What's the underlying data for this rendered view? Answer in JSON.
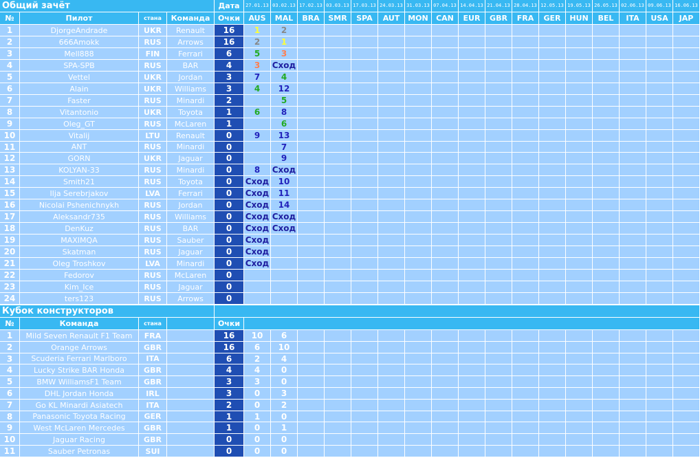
{
  "colors": {
    "header_bg": "#38b8f2",
    "cell_bg": "#a2d0ff",
    "points_bg": "#1f4eb3",
    "grid_line": "#ffffff"
  },
  "drivers": {
    "section_title": "Общий зачёт",
    "headers": {
      "no": "№",
      "pilot": "Пилот",
      "country": "стана",
      "team": "Команда",
      "date": "Дата",
      "points": "Очки"
    },
    "dates": [
      "27.01.13",
      "03.02.13",
      "17.02.13",
      "03.03.13",
      "17.03.13",
      "24.03.13",
      "31.03.13",
      "07.04.13",
      "14.04.13",
      "21.04.13",
      "28.04.13",
      "12.05.13",
      "19.05.13",
      "26.05.13",
      "02.06.13",
      "09.06.13",
      "16.06.13"
    ],
    "races": [
      "AUS",
      "MAL",
      "BRA",
      "SMR",
      "SPA",
      "AUT",
      "MON",
      "CAN",
      "EUR",
      "GBR",
      "FRA",
      "GER",
      "HUN",
      "BEL",
      "ITA",
      "USA",
      "JAP"
    ],
    "rows": [
      {
        "no": "1",
        "name": "DjorgeAndrade",
        "country": "UKR",
        "team": "Renault",
        "points": "16",
        "results": [
          {
            "v": "1",
            "c": "#ffff33"
          },
          {
            "v": "2",
            "c": "#888888"
          }
        ]
      },
      {
        "no": "2",
        "name": "666Amokk",
        "country": "RUS",
        "team": "Arrows",
        "points": "16",
        "results": [
          {
            "v": "2",
            "c": "#888888"
          },
          {
            "v": "1",
            "c": "#ffff33"
          }
        ]
      },
      {
        "no": "3",
        "name": "Mell888",
        "country": "FIN",
        "team": "Ferrari",
        "points": "6",
        "results": [
          {
            "v": "5",
            "c": "#22aa22"
          },
          {
            "v": "3",
            "c": "#ff7f50"
          }
        ]
      },
      {
        "no": "4",
        "name": "SPA-SPB",
        "country": "RUS",
        "team": "BAR",
        "points": "4",
        "results": [
          {
            "v": "3",
            "c": "#ff7f50"
          },
          {
            "v": "Сход",
            "c": "#2020a0"
          }
        ]
      },
      {
        "no": "5",
        "name": "Vettel",
        "country": "UKR",
        "team": "Jordan",
        "points": "3",
        "results": [
          {
            "v": "7",
            "c": "#2222bb"
          },
          {
            "v": "4",
            "c": "#22aa22"
          }
        ]
      },
      {
        "no": "6",
        "name": "Alain",
        "country": "UKR",
        "team": "Williams",
        "points": "3",
        "results": [
          {
            "v": "4",
            "c": "#22aa22"
          },
          {
            "v": "12",
            "c": "#2222bb"
          }
        ]
      },
      {
        "no": "7",
        "name": "Faster",
        "country": "RUS",
        "team": "Minardi",
        "points": "2",
        "results": [
          {
            "v": "",
            "c": ""
          },
          {
            "v": "5",
            "c": "#22aa22"
          }
        ]
      },
      {
        "no": "8",
        "name": "Vitantonio",
        "country": "UKR",
        "team": "Toyota",
        "points": "1",
        "results": [
          {
            "v": "6",
            "c": "#22aa22"
          },
          {
            "v": "8",
            "c": "#2222bb"
          }
        ]
      },
      {
        "no": "9",
        "name": "Oleg_GT",
        "country": "RUS",
        "team": "McLaren",
        "points": "1",
        "results": [
          {
            "v": "",
            "c": ""
          },
          {
            "v": "6",
            "c": "#22aa22"
          }
        ]
      },
      {
        "no": "10",
        "name": "Vitalij",
        "country": "LTU",
        "team": "Renault",
        "points": "0",
        "results": [
          {
            "v": "9",
            "c": "#2222bb"
          },
          {
            "v": "13",
            "c": "#2222bb"
          }
        ]
      },
      {
        "no": "11",
        "name": "ANT",
        "country": "RUS",
        "team": "Minardi",
        "points": "0",
        "results": [
          {
            "v": "",
            "c": ""
          },
          {
            "v": "7",
            "c": "#2222bb"
          }
        ]
      },
      {
        "no": "12",
        "name": "GORN",
        "country": "UKR",
        "team": "Jaguar",
        "points": "0",
        "results": [
          {
            "v": "",
            "c": ""
          },
          {
            "v": "9",
            "c": "#2222bb"
          }
        ]
      },
      {
        "no": "13",
        "name": "KOLYAN-33",
        "country": "RUS",
        "team": "Minardi",
        "points": "0",
        "results": [
          {
            "v": "8",
            "c": "#2222bb"
          },
          {
            "v": "Сход",
            "c": "#2020a0"
          }
        ]
      },
      {
        "no": "14",
        "name": "Smith21",
        "country": "RUS",
        "team": "Toyota",
        "points": "0",
        "results": [
          {
            "v": "Сход",
            "c": "#2020a0"
          },
          {
            "v": "10",
            "c": "#2222bb"
          }
        ]
      },
      {
        "no": "15",
        "name": "Ilja Serebrjakov",
        "country": "LVA",
        "team": "Ferrari",
        "points": "0",
        "results": [
          {
            "v": "Сход",
            "c": "#2020a0"
          },
          {
            "v": "11",
            "c": "#2222bb"
          }
        ]
      },
      {
        "no": "16",
        "name": "Nicolai Pshenichnykh",
        "country": "RUS",
        "team": "Jordan",
        "points": "0",
        "results": [
          {
            "v": "Сход",
            "c": "#2020a0"
          },
          {
            "v": "14",
            "c": "#2222bb"
          }
        ]
      },
      {
        "no": "17",
        "name": "Aleksandr735",
        "country": "RUS",
        "team": "Williams",
        "points": "0",
        "results": [
          {
            "v": "Сход",
            "c": "#2020a0"
          },
          {
            "v": "Сход",
            "c": "#2020a0"
          }
        ]
      },
      {
        "no": "18",
        "name": "DenKuz",
        "country": "RUS",
        "team": "BAR",
        "points": "0",
        "results": [
          {
            "v": "Сход",
            "c": "#2020a0"
          },
          {
            "v": "Сход",
            "c": "#2020a0"
          }
        ]
      },
      {
        "no": "19",
        "name": "MAXIMQA",
        "country": "RUS",
        "team": "Sauber",
        "points": "0",
        "results": [
          {
            "v": "Сход",
            "c": "#2020a0"
          },
          {
            "v": "",
            "c": ""
          }
        ]
      },
      {
        "no": "20",
        "name": "Skatman",
        "country": "RUS",
        "team": "Jaguar",
        "points": "0",
        "results": [
          {
            "v": "Сход",
            "c": "#2020a0"
          },
          {
            "v": "",
            "c": ""
          }
        ]
      },
      {
        "no": "21",
        "name": "Oleg Troshkov",
        "country": "LVA",
        "team": "Minardi",
        "points": "0",
        "results": [
          {
            "v": "Сход",
            "c": "#2020a0"
          },
          {
            "v": "",
            "c": ""
          }
        ]
      },
      {
        "no": "22",
        "name": "Fedorov",
        "country": "RUS",
        "team": "McLaren",
        "points": "0",
        "results": []
      },
      {
        "no": "23",
        "name": "Kim_Ice",
        "country": "RUS",
        "team": "Jaguar",
        "points": "0",
        "results": []
      },
      {
        "no": "24",
        "name": "ters123",
        "country": "RUS",
        "team": "Arrows",
        "points": "0",
        "results": []
      }
    ]
  },
  "constructors": {
    "section_title": "Кубок конструкторов",
    "headers": {
      "no": "№",
      "team": "Команда",
      "country": "стана",
      "points": "Очки"
    },
    "rows": [
      {
        "no": "1",
        "team": "Mild Seven Renault F1 Team",
        "country": "FRA",
        "points": "16",
        "results": [
          "10",
          "6"
        ]
      },
      {
        "no": "2",
        "team": "Orange Arrows",
        "country": "GBR",
        "points": "16",
        "results": [
          "6",
          "10"
        ]
      },
      {
        "no": "3",
        "team": "Scuderia Ferrari Marlboro",
        "country": "ITA",
        "points": "6",
        "results": [
          "2",
          "4"
        ]
      },
      {
        "no": "4",
        "team": "Lucky Strike BAR Honda",
        "country": "GBR",
        "points": "4",
        "results": [
          "4",
          "0"
        ]
      },
      {
        "no": "5",
        "team": "BMW WilliamsF1 Team",
        "country": "GBR",
        "points": "3",
        "results": [
          "3",
          "0"
        ]
      },
      {
        "no": "6",
        "team": "DHL Jordan Honda",
        "country": "IRL",
        "points": "3",
        "results": [
          "0",
          "3"
        ]
      },
      {
        "no": "7",
        "team": "Go KL Minardi Asiatech",
        "country": "ITA",
        "points": "2",
        "results": [
          "0",
          "2"
        ]
      },
      {
        "no": "8",
        "team": "Panasonic Toyota Racing",
        "country": "GER",
        "points": "1",
        "results": [
          "1",
          "0"
        ]
      },
      {
        "no": "9",
        "team": "West McLaren Mercedes",
        "country": "GBR",
        "points": "1",
        "results": [
          "0",
          "1"
        ]
      },
      {
        "no": "10",
        "team": "Jaguar Racing",
        "country": "GBR",
        "points": "0",
        "results": [
          "0",
          "0"
        ]
      },
      {
        "no": "11",
        "team": "Sauber Petronas",
        "country": "SUI",
        "points": "0",
        "results": [
          "0",
          "0"
        ]
      }
    ]
  }
}
